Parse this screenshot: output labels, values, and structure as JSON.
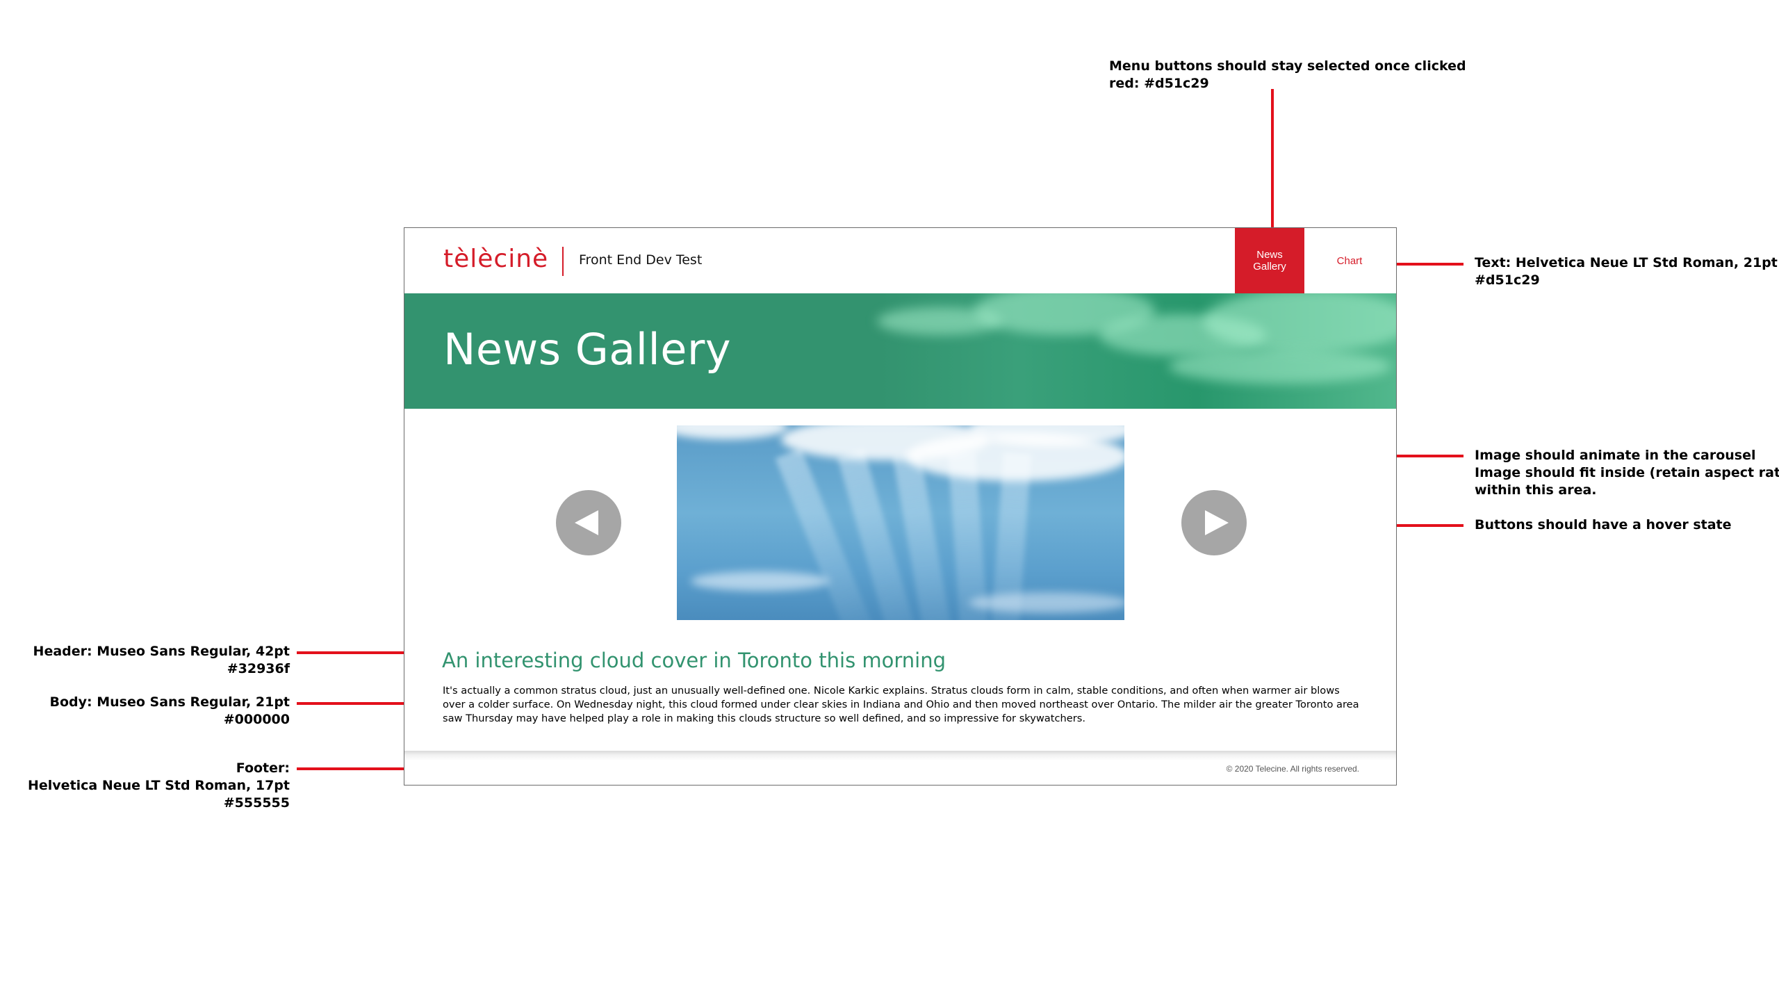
{
  "annotations": {
    "menu_note": [
      "Menu buttons should stay selected once clicked",
      "red: #d51c29"
    ],
    "text_note": [
      "Text: Helvetica Neue LT Std Roman,  21pt",
      "#d51c29"
    ],
    "image_note": [
      "Image should animate in the carousel",
      "Image should fit inside (retain aspect ratio)",
      "within this area."
    ],
    "buttons_note": [
      "Buttons should have a hover state"
    ],
    "header_note": [
      "Header: Museo Sans Regular, 42pt",
      "#32936f"
    ],
    "body_note": [
      "Body: Museo Sans Regular, 21pt",
      "#000000"
    ],
    "footer_note": [
      "Footer:",
      "Helvetica Neue LT Std Roman,  17pt",
      "#555555"
    ]
  },
  "header": {
    "logo": "tèlècinè",
    "subtitle": "Front End Dev Test",
    "menu": [
      {
        "line1": "News",
        "line2": "Gallery",
        "selected": true
      },
      {
        "line1": "Chart",
        "line2": "",
        "selected": false
      }
    ]
  },
  "banner": {
    "title": "News Gallery"
  },
  "carousel": {
    "prev_icon": "triangle-left-icon",
    "next_icon": "triangle-right-icon",
    "image_subject": "clouds-sky"
  },
  "article": {
    "title": "An interesting cloud cover in Toronto this morning",
    "body": "It's actually a common stratus cloud, just an unusually well-defined one. Nicole Karkic explains. Stratus clouds form in calm, stable conditions, and often when warmer air blows over a colder surface. On Wednesday night, this cloud formed under clear skies in Indiana and Ohio and then moved northeast over Ontario. The milder air the greater Toronto area saw Thursday may have helped play a role in making this clouds structure so well defined, and so impressive for skywatchers."
  },
  "footer": {
    "copyright": "© 2020 Telecine. All rights reserved."
  },
  "colors": {
    "brand_red": "#d51c29",
    "brand_green": "#32936f",
    "footer_text": "#555555",
    "annotation_line": "#e3101b"
  }
}
